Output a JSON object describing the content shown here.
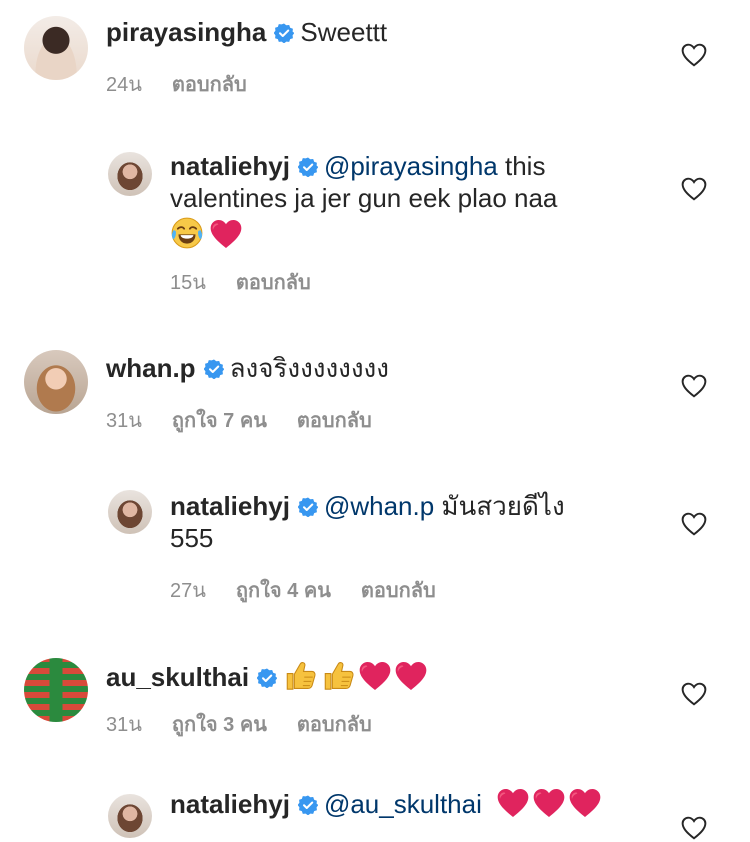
{
  "comments": [
    {
      "username": "pirayasingha",
      "text": "Sweettt",
      "time": "24น",
      "reply_label": "ตอบกลับ"
    },
    {
      "username": "nataliehyj",
      "mention": "@pirayasingha",
      "text_line1": " this",
      "text_line2": "valentines ja jer gun eek plao naa",
      "emojis": [
        "face-with-tears-of-joy",
        "red-heart"
      ],
      "time": "15น",
      "reply_label": "ตอบกลับ"
    },
    {
      "username": "whan.p",
      "text": "ลงจริงงงงงงงง",
      "time": "31น",
      "likes": "ถูกใจ 7 คน",
      "reply_label": "ตอบกลับ"
    },
    {
      "username": "nataliehyj",
      "mention": "@whan.p",
      "text_line1": " มันสวยดีไง",
      "text_line2": "555",
      "time": "27น",
      "likes": "ถูกใจ 4 คน",
      "reply_label": "ตอบกลับ"
    },
    {
      "username": "au_skulthai",
      "emojis": [
        "thumbs-up",
        "thumbs-up",
        "red-heart",
        "red-heart"
      ],
      "time": "31น",
      "likes": "ถูกใจ 3 คน",
      "reply_label": "ตอบกลับ"
    },
    {
      "username": "nataliehyj",
      "mention": "@au_skulthai",
      "emojis": [
        "red-heart",
        "red-heart",
        "red-heart"
      ]
    }
  ],
  "colors": {
    "text": "#262626",
    "meta": "#8e8e8e",
    "mention": "#00376b",
    "verified": "#3897f0",
    "heart_emoji": "#e0245e"
  }
}
